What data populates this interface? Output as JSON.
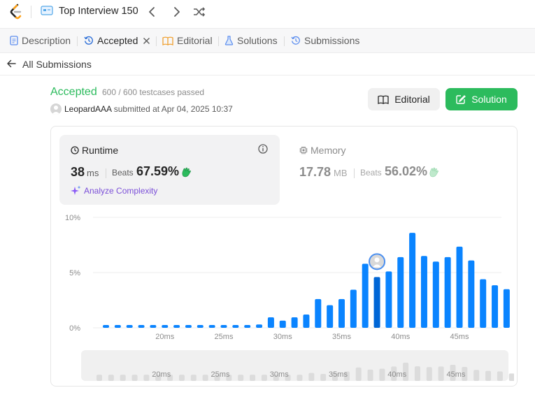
{
  "header": {
    "list_title": "Top Interview 150"
  },
  "tabs": [
    {
      "label": "Description"
    },
    {
      "label": "Accepted"
    },
    {
      "label": "Editorial"
    },
    {
      "label": "Solutions"
    },
    {
      "label": "Submissions"
    }
  ],
  "back": {
    "label": "All Submissions"
  },
  "submission": {
    "status": "Accepted",
    "passed": "600 / 600 testcases passed",
    "user": "LeopardAAA",
    "submitted_text": "submitted at Apr 04, 2025 10:37"
  },
  "buttons": {
    "editorial": "Editorial",
    "solution": "Solution"
  },
  "runtime": {
    "label": "Runtime",
    "value": "38",
    "unit": "ms",
    "beats_label": "Beats",
    "beats_value": "67.59%",
    "analyze": "Analyze Complexity"
  },
  "memory": {
    "label": "Memory",
    "value": "17.78",
    "unit": "MB",
    "beats_label": "Beats",
    "beats_value": "56.02%"
  },
  "colors": {
    "accepted": "#2cbb5d",
    "bar": "#0a84ff",
    "bar_highlight": "#0066d6",
    "analyze": "#7b4fd8"
  },
  "chart_data": {
    "type": "bar",
    "x": [
      15,
      16,
      17,
      18,
      19,
      20,
      21,
      22,
      23,
      24,
      25,
      26,
      27,
      28,
      29,
      30,
      31,
      32,
      33,
      34,
      35,
      36,
      37,
      38,
      39,
      40,
      41,
      42,
      43,
      44,
      45,
      46,
      47,
      48
    ],
    "values": [
      0.25,
      0.25,
      0.25,
      0.25,
      0.25,
      0.25,
      0.25,
      0.25,
      0.25,
      0.25,
      0.25,
      0.25,
      0.25,
      0.3,
      0.95,
      0.65,
      0.95,
      1.2,
      2.6,
      2.05,
      2.6,
      3.45,
      5.8,
      4.6,
      5.1,
      6.4,
      8.6,
      6.5,
      6.0,
      6.4,
      7.35,
      6.1,
      4.4,
      3.85,
      3.5,
      2.3
    ],
    "x_ticks": [
      "20ms",
      "25ms",
      "30ms",
      "35ms",
      "40ms",
      "45ms"
    ],
    "y_ticks": [
      "10%",
      "5%",
      "0%"
    ],
    "ylim": [
      0,
      10
    ],
    "highlight_x": 38,
    "grid": true
  }
}
